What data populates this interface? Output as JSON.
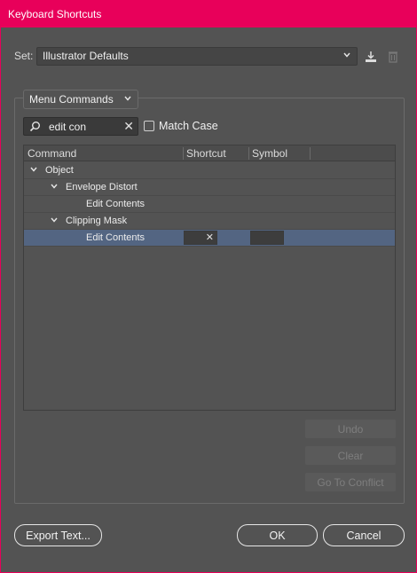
{
  "window": {
    "title": "Keyboard Shortcuts"
  },
  "set": {
    "label": "Set:",
    "value": "Illustrator Defaults"
  },
  "filter": {
    "category": "Menu Commands"
  },
  "search": {
    "value": "edit con"
  },
  "match_case": {
    "label": "Match Case",
    "checked": false
  },
  "table": {
    "columns": [
      "Command",
      "Shortcut",
      "Symbol"
    ],
    "rows": [
      {
        "label": "Object",
        "level": 0,
        "expanded": true
      },
      {
        "label": "Envelope Distort",
        "level": 1,
        "expanded": true
      },
      {
        "label": "Edit Contents",
        "level": 2
      },
      {
        "label": "Clipping Mask",
        "level": 1,
        "expanded": true
      },
      {
        "label": "Edit Contents",
        "level": 2,
        "selected": true
      }
    ]
  },
  "actions": {
    "undo": "Undo",
    "clear": "Clear",
    "go_to_conflict": "Go To Conflict"
  },
  "footer": {
    "export": "Export Text...",
    "ok": "OK",
    "cancel": "Cancel"
  },
  "colors": {
    "titlebar": "#e8005a",
    "background": "#535353",
    "selection": "#536582"
  },
  "icons": {
    "save": "save-set-icon",
    "delete": "trash-icon",
    "search": "search-icon"
  }
}
